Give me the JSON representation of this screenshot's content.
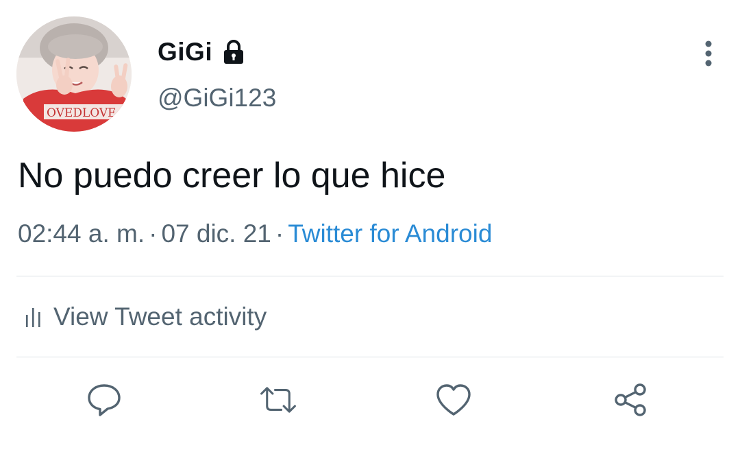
{
  "tweet": {
    "author": {
      "display_name": "GiGi",
      "handle": "@GiGi123",
      "avatar": "avatar-photo",
      "protected_icon": "lock-icon"
    },
    "menu_icon": "more-vertical-icon",
    "text": "No puedo creer lo que hice",
    "time": "02:44 a. m.",
    "separator": "·",
    "date": "07 dic. 21",
    "source": "Twitter for Android",
    "activity": {
      "icon": "analytics-icon",
      "label": "View Tweet activity"
    },
    "actions": [
      {
        "name": "reply",
        "icon": "reply-icon"
      },
      {
        "name": "retweet",
        "icon": "retweet-icon"
      },
      {
        "name": "like",
        "icon": "heart-icon"
      },
      {
        "name": "share",
        "icon": "share-icon"
      }
    ]
  },
  "colors": {
    "primary_text": "#0f1419",
    "secondary_text": "#536471",
    "link": "#2a8bd5",
    "divider": "#dbe1e5",
    "icon": "#536471"
  }
}
